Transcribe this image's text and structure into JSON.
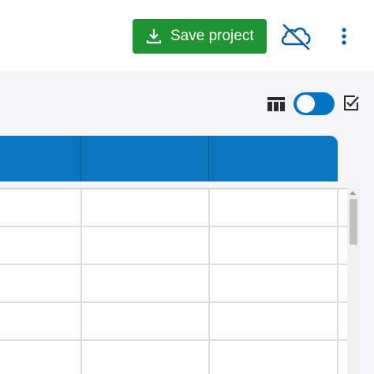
{
  "toolbar": {
    "save_label": "Save project",
    "save_icon": "download-icon",
    "cloud_icon": "cloud-off-icon",
    "menu_icon": "more-vert-icon"
  },
  "controls": {
    "columns_icon": "view-columns-icon",
    "toggle_state": "off",
    "checkbox_icon": "check-box-icon"
  },
  "colors": {
    "save_button": "#1e9432",
    "accent_blue": "#0a76c0",
    "panel_bg": "#f4f4f9"
  },
  "table": {
    "columns": [
      "",
      "",
      ""
    ],
    "rows": [
      [
        "",
        "",
        ""
      ],
      [
        "",
        "",
        ""
      ],
      [
        "",
        "",
        ""
      ],
      [
        "",
        "",
        ""
      ],
      [
        "",
        "",
        ""
      ]
    ]
  }
}
